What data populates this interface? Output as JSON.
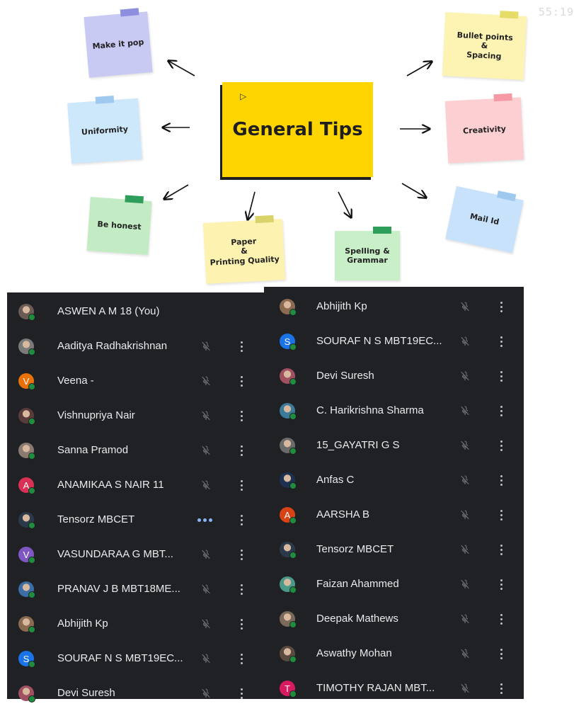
{
  "timestamp": "55:19",
  "slide": {
    "title": "General Tips",
    "notes": [
      {
        "key": "make-it-pop",
        "label": "Make it pop",
        "color": "#c9caf4"
      },
      {
        "key": "uniformity",
        "label": "Uniformity",
        "color": "#cde7fb"
      },
      {
        "key": "be-honest",
        "label": "Be honest",
        "color": "#c4ecc4"
      },
      {
        "key": "paper-printing",
        "label": "Paper\n&\nPrinting Quality",
        "color": "#fdf2b0"
      },
      {
        "key": "spelling-grammar",
        "label": "Spelling &\nGrammar",
        "color": "#c8efc8"
      },
      {
        "key": "mail-id",
        "label": "Mail Id",
        "color": "#c8e2fb"
      },
      {
        "key": "creativity",
        "label": "Creativity",
        "color": "#fccfd3"
      },
      {
        "key": "bullet-points",
        "label": "Bullet points\n&\nSpacing",
        "color": "#fdf3b3"
      }
    ]
  },
  "participants_left": [
    {
      "name": "ASWEN A M 18 (You)",
      "avatar": "photo",
      "color": "#6b5b55",
      "initial": "",
      "status": "none"
    },
    {
      "name": "Aaditya Radhakrishnan",
      "avatar": "photo",
      "color": "#7a7a7a",
      "initial": "",
      "status": "muted"
    },
    {
      "name": "Veena -",
      "avatar": "initial",
      "color": "#e8710a",
      "initial": "V",
      "status": "muted"
    },
    {
      "name": "Vishnupriya Nair",
      "avatar": "photo",
      "color": "#5a3b3b",
      "initial": "",
      "status": "muted"
    },
    {
      "name": "Sanna Pramod",
      "avatar": "photo",
      "color": "#8a7a70",
      "initial": "",
      "status": "muted"
    },
    {
      "name": "ANAMIKAA S NAIR 11",
      "avatar": "initial",
      "color": "#d93055",
      "initial": "A",
      "status": "muted"
    },
    {
      "name": "Tensorz MBCET",
      "avatar": "photo",
      "color": "#2b3a4a",
      "initial": "",
      "status": "talking"
    },
    {
      "name": "VASUNDARAA G MBT...",
      "avatar": "initial",
      "color": "#7e57c2",
      "initial": "V",
      "status": "muted"
    },
    {
      "name": "PRANAV J B MBT18ME...",
      "avatar": "photo",
      "color": "#3a6ea5",
      "initial": "",
      "status": "muted"
    },
    {
      "name": "Abhijith Kp",
      "avatar": "photo",
      "color": "#8a6a50",
      "initial": "",
      "status": "muted"
    },
    {
      "name": "SOURAF N S MBT19EC...",
      "avatar": "initial",
      "color": "#1a73e8",
      "initial": "S",
      "status": "muted"
    },
    {
      "name": "Devi Suresh",
      "avatar": "photo",
      "color": "#a05060",
      "initial": "",
      "status": "muted"
    }
  ],
  "participants_right": [
    {
      "name": "Abhijith Kp",
      "avatar": "photo",
      "color": "#8a6a50",
      "initial": "",
      "status": "muted"
    },
    {
      "name": "SOURAF N S MBT19EC...",
      "avatar": "initial",
      "color": "#1a73e8",
      "initial": "S",
      "status": "muted"
    },
    {
      "name": "Devi Suresh",
      "avatar": "photo",
      "color": "#a05060",
      "initial": "",
      "status": "muted"
    },
    {
      "name": "C. Harikrishna Sharma",
      "avatar": "photo",
      "color": "#3c7a9a",
      "initial": "",
      "status": "muted"
    },
    {
      "name": "15_GAYATRI G S",
      "avatar": "photo",
      "color": "#6a6a6a",
      "initial": "",
      "status": "muted"
    },
    {
      "name": "Anfas C",
      "avatar": "photo",
      "color": "#1c3050",
      "initial": "",
      "status": "muted"
    },
    {
      "name": "AARSHA B",
      "avatar": "initial",
      "color": "#d84315",
      "initial": "A",
      "status": "muted"
    },
    {
      "name": "Tensorz MBCET",
      "avatar": "photo",
      "color": "#2b3a4a",
      "initial": "",
      "status": "muted"
    },
    {
      "name": "Faizan Ahammed",
      "avatar": "photo",
      "color": "#4a9a8a",
      "initial": "",
      "status": "muted"
    },
    {
      "name": "Deepak Mathews",
      "avatar": "photo",
      "color": "#7a6a5a",
      "initial": "",
      "status": "muted"
    },
    {
      "name": "Aswathy Mohan",
      "avatar": "photo",
      "color": "#5a4a40",
      "initial": "",
      "status": "muted"
    },
    {
      "name": "TIMOTHY RAJAN MBT...",
      "avatar": "initial",
      "color": "#d81b60",
      "initial": "T",
      "status": "muted"
    }
  ]
}
